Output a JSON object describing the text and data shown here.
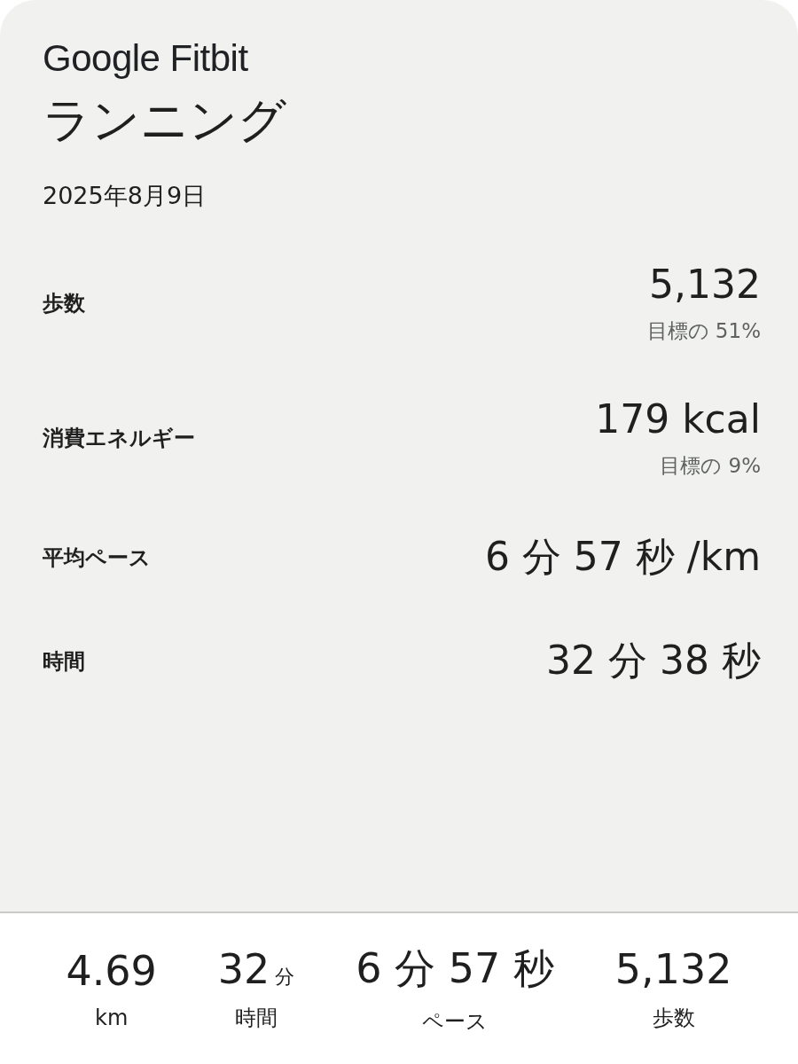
{
  "brand": "Google Fitbit",
  "title": "ランニング",
  "date": "2025年8月9日",
  "stats": [
    {
      "label": "歩数",
      "value": "5,132",
      "goal": "目標の 51%"
    },
    {
      "label": "消費エネルギー",
      "value": "179 kcal",
      "goal": "目標の 9%"
    },
    {
      "label": "平均ペース",
      "value": "6 分 57 秒 /km"
    },
    {
      "label": "時間",
      "value": "32 分 38 秒"
    }
  ],
  "summary": [
    {
      "value": "4.69",
      "label": "km"
    },
    {
      "value": "32",
      "unit": "分",
      "label": "時間"
    },
    {
      "value": "6 分 57 秒",
      "label": "ペース"
    },
    {
      "value": "5,132",
      "label": "歩数"
    }
  ]
}
